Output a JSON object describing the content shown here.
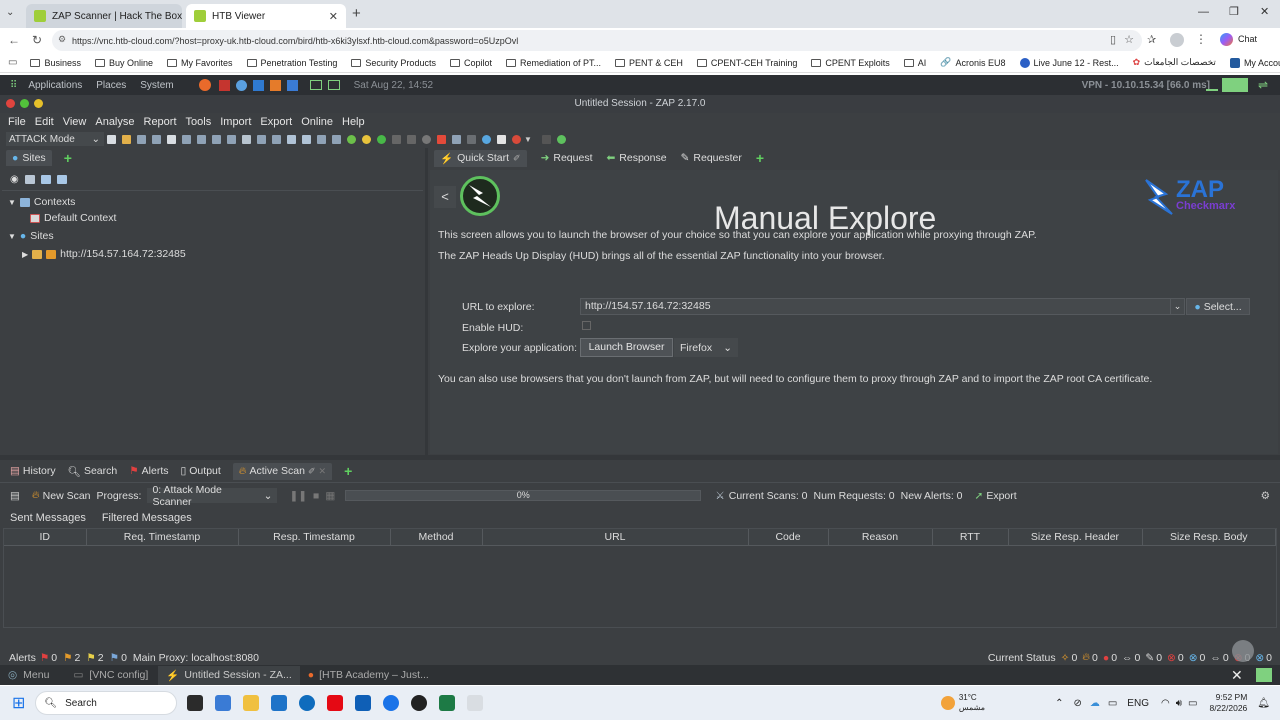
{
  "browser": {
    "tabs": [
      {
        "title": "ZAP Scanner | Hack The Box Acad"
      },
      {
        "title": "HTB Viewer"
      }
    ],
    "url": "https://vnc.htb-cloud.com/?host=proxy-uk.htb-cloud.com/bird/htb-x6ki3ylsxf.htb-cloud.com&password=o5UzpOvl",
    "chat_label": "Chat",
    "bookmarks": [
      "Business",
      "Buy Online",
      "My Favorites",
      "Penetration Testing",
      "Security Products",
      "Copilot",
      "Remediation of PT...",
      "PENT & CEH",
      "CPENT-CEH Training",
      "CPENT Exploits",
      "AI",
      "Acronis EU8",
      "Live June 12 - Rest...",
      "تخصصات الجامعات",
      "My Account | Gart..."
    ]
  },
  "linux_panel": {
    "menus": [
      "Applications",
      "Places",
      "System"
    ],
    "datetime": "Sat Aug 22, 14:52",
    "vpn": "VPN - 10.10.15.34 [66.0 ms]"
  },
  "window": {
    "title": "Untitled Session - ZAP 2.17.0"
  },
  "menubar": [
    "File",
    "Edit",
    "View",
    "Analyse",
    "Report",
    "Tools",
    "Import",
    "Export",
    "Online",
    "Help"
  ],
  "toolbar": {
    "mode": "ATTACK Mode"
  },
  "sites_panel": {
    "tab": "Sites",
    "contexts": "Contexts",
    "default_context": "Default Context",
    "sites": "Sites",
    "site_url": "http://154.57.164.72:32485"
  },
  "right_tabs": [
    "Quick Start",
    "Request",
    "Response",
    "Requester"
  ],
  "manual": {
    "title": "Manual Explore",
    "desc1": "This screen allows you to launch the browser of your choice so that you can explore your application while proxying through ZAP.",
    "desc2": "The ZAP Heads Up Display (HUD) brings all of the essential ZAP functionality into your browser.",
    "url_label": "URL to explore:",
    "url_value": "http://154.57.164.72:32485",
    "select_label": "Select...",
    "hud_label": "Enable HUD:",
    "explore_label": "Explore your application:",
    "launch_label": "Launch Browser",
    "browser_value": "Firefox",
    "note": "You can also use browsers that you don't launch from ZAP, but will need to configure them to proxy through ZAP and to import the ZAP root CA certificate.",
    "logo_text": "ZAP",
    "logo_sub": "Checkmarx"
  },
  "bottom_tabs": [
    "History",
    "Search",
    "Alerts",
    "Output",
    "Active Scan"
  ],
  "scan": {
    "new_scan": "New Scan",
    "progress_label": "Progress:",
    "progress_value": "0: Attack Mode Scanner",
    "progress_pct": "0%",
    "current_scans": "Current Scans: 0",
    "num_requests": "Num Requests: 0",
    "new_alerts": "New Alerts: 0",
    "export": "Export",
    "subtabs": [
      "Sent Messages",
      "Filtered Messages"
    ],
    "columns": [
      "ID",
      "Req. Timestamp",
      "Resp. Timestamp",
      "Method",
      "URL",
      "Code",
      "Reason",
      "RTT",
      "Size Resp. Header",
      "Size Resp. Body"
    ]
  },
  "statusbar": {
    "alerts": "Alerts",
    "a_red": "0",
    "a_orange": "2",
    "a_yellow": "2",
    "a_blue": "0",
    "proxy": "Main Proxy: localhost:8080",
    "current_status": "Current Status",
    "counts": [
      "0",
      "0",
      "0",
      "0",
      "0",
      "0",
      "0",
      "0",
      "0",
      "0"
    ]
  },
  "vnc_tasks": [
    "Menu",
    "[VNC config]",
    "Untitled Session - ZA...",
    "[HTB Academy – Just..."
  ],
  "taskbar": {
    "search": "Search",
    "temp": "31°C",
    "weather": "مشمس",
    "lang": "ENG",
    "time": "9:52 PM",
    "date": "8/22/2026"
  }
}
